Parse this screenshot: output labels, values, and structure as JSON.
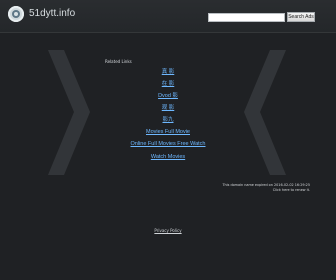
{
  "header": {
    "site_name": "51dytt.info",
    "search_placeholder": "",
    "search_button_label": "Search Ads"
  },
  "main": {
    "related_links_label": "Related Links",
    "links": [
      "真 影",
      "在 影",
      "Dvod 影",
      "观 影",
      "影九",
      "Movies Full Movie",
      "Online Full Movies Free Watch",
      "Watch Movies"
    ]
  },
  "notice": {
    "line1": "This domain name expired on 2016-02-02 16:29:25",
    "line2": "Click here to renew it."
  },
  "footer": {
    "privacy_policy_label": "Privacy Policy"
  },
  "colors": {
    "background": "#1f2124",
    "link": "#6eb8ff",
    "header": "#2a2d30"
  },
  "icons": {
    "logo": "site-logo-icon",
    "left_chevron": "chevron-left-icon",
    "right_chevron": "chevron-right-icon"
  }
}
